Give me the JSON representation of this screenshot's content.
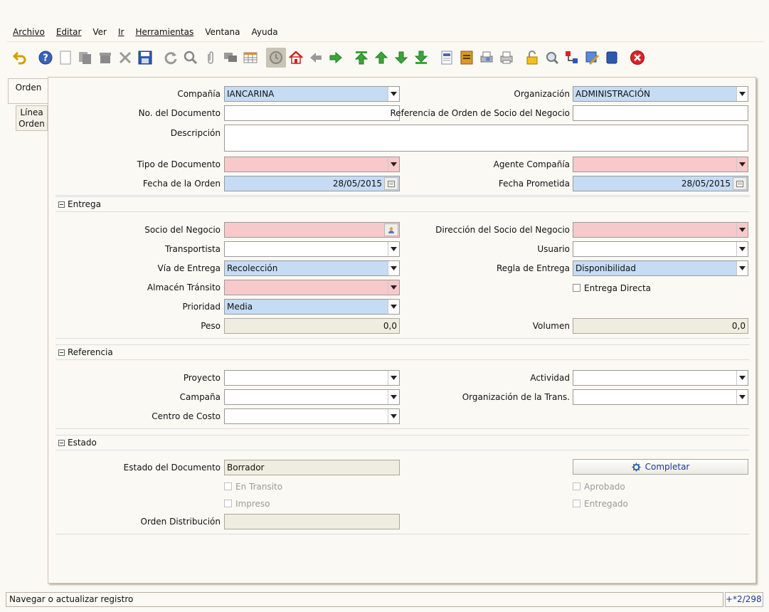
{
  "menu": {
    "items": [
      "Archivo",
      "Editar",
      "Ver",
      "Ir",
      "Herramientas",
      "Ventana",
      "Ayuda"
    ]
  },
  "toolbar": {
    "icons": [
      "undo-icon",
      "help-icon",
      "new-record-icon",
      "copy-record-icon",
      "delete-icon",
      "delete-selection-icon",
      "save-icon",
      "refresh-icon",
      "find-icon",
      "attachment-icon",
      "chat-icon",
      "grid-toggle-icon",
      "history-icon",
      "home-icon",
      "previous-icon",
      "next-icon",
      "first-record-icon",
      "previous-record-icon",
      "next-record-icon",
      "last-record-icon",
      "report-icon",
      "archive-icon",
      "print-preview-icon",
      "print-icon",
      "lock-icon",
      "zoom-across-icon",
      "workflow-icon",
      "product-info-icon",
      "active-workflows-icon",
      "close-icon"
    ]
  },
  "tabs": {
    "orden": "Orden",
    "linea_1": "Línea",
    "linea_2": "Orden"
  },
  "form": {
    "compania": {
      "label": "Compañía",
      "value": "IANCARINA"
    },
    "organizacion": {
      "label": "Organización",
      "value": "ADMINISTRACIÓN"
    },
    "no_documento": {
      "label": "No. del Documento",
      "value": ""
    },
    "referencia_orden": {
      "label": "Referencia de Orden de Socio del Negocio",
      "value": ""
    },
    "descripcion": {
      "label": "Descripción",
      "value": ""
    },
    "tipo_documento": {
      "label": "Tipo de Documento",
      "value": ""
    },
    "agente_compania": {
      "label": "Agente Compañía",
      "value": ""
    },
    "fecha_orden": {
      "label": "Fecha de la Orden",
      "value": "28/05/2015"
    },
    "fecha_prometida": {
      "label": "Fecha Prometida",
      "value": "28/05/2015"
    }
  },
  "sections": {
    "entrega": "Entrega",
    "referencia": "Referencia",
    "estado": "Estado"
  },
  "entrega": {
    "socio": {
      "label": "Socio del Negocio",
      "value": ""
    },
    "direccion_socio": {
      "label": "Dirección del Socio del Negocio",
      "value": ""
    },
    "transportista": {
      "label": "Transportista",
      "value": ""
    },
    "usuario": {
      "label": "Usuario",
      "value": ""
    },
    "via_entrega": {
      "label": "Vía de Entrega",
      "value": "Recolección"
    },
    "regla_entrega": {
      "label": "Regla de Entrega",
      "value": "Disponibilidad"
    },
    "almacen_transito": {
      "label": "Almacén Tránsito",
      "value": ""
    },
    "entrega_directa": {
      "label": "Entrega Directa"
    },
    "prioridad": {
      "label": "Prioridad",
      "value": "Media"
    },
    "peso": {
      "label": "Peso",
      "value": "0,0"
    },
    "volumen": {
      "label": "Volumen",
      "value": "0,0"
    }
  },
  "referencia": {
    "proyecto": {
      "label": "Proyecto",
      "value": ""
    },
    "actividad": {
      "label": "Actividad",
      "value": ""
    },
    "campana": {
      "label": "Campaña",
      "value": ""
    },
    "org_trans": {
      "label": "Organización de la Trans.",
      "value": ""
    },
    "centro_costo": {
      "label": "Centro de Costo",
      "value": ""
    }
  },
  "estado": {
    "estado_documento": {
      "label": "Estado del Documento",
      "value": "Borrador"
    },
    "completar": "Completar",
    "en_transito": "En Transito",
    "aprobado": "Aprobado",
    "impreso": "Impreso",
    "entregado": "Entregado",
    "orden_distribucion": {
      "label": "Orden Distribución",
      "value": ""
    }
  },
  "status": {
    "message": "Navegar o actualizar registro",
    "count": "+*2/298"
  },
  "colors": {
    "mandatory": "#f8c9cb",
    "filled": "#c6dcf4",
    "readonly": "#eeede0",
    "accent": "#1a3a9a"
  }
}
